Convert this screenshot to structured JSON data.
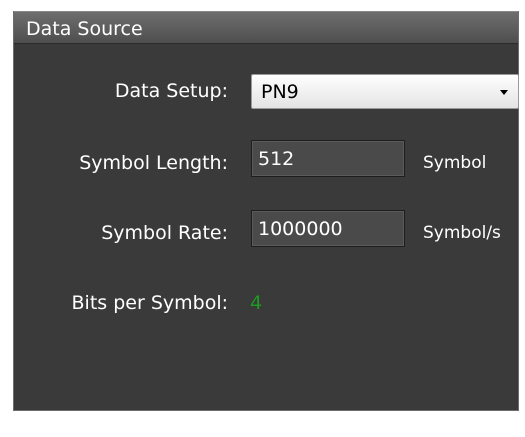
{
  "panel": {
    "title": "Data Source"
  },
  "data_setup": {
    "label": "Data Setup:",
    "selected": "PN9"
  },
  "symbol_length": {
    "label": "Symbol Length:",
    "value": "512",
    "unit": "Symbol"
  },
  "symbol_rate": {
    "label": "Symbol Rate:",
    "value": "1000000",
    "unit": "Symbol/s"
  },
  "bits_per_symbol": {
    "label": "Bits per Symbol:",
    "value": "4"
  },
  "colors": {
    "panel_background": "#3a3a3a",
    "value_green": "#1f9a1f"
  },
  "icons": {
    "dropdown_arrow": "chevron-down-icon"
  }
}
